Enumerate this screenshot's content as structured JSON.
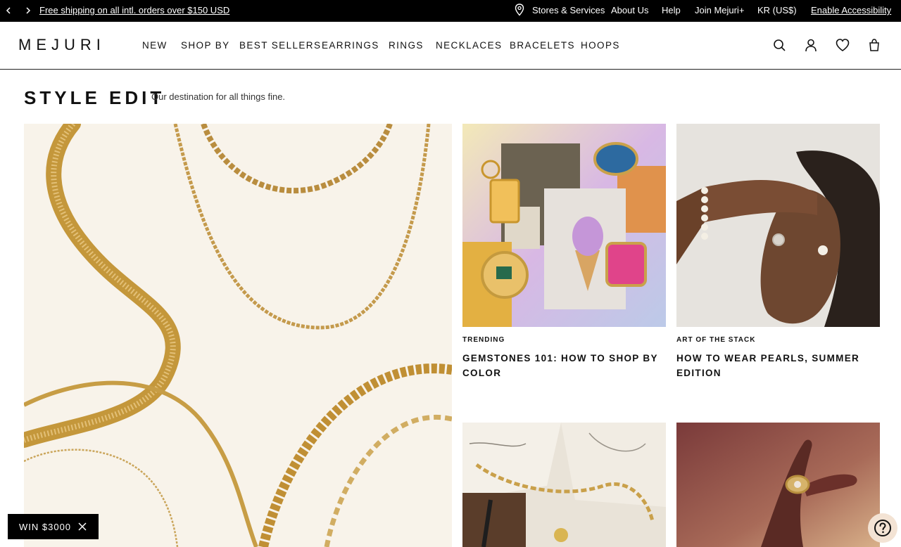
{
  "topbar": {
    "promo": "Free shipping on all intl. orders over $150 USD",
    "stores": "Stores & Services",
    "about": "About Us",
    "help": "Help",
    "join": "Join Mejuri+",
    "currency": "KR (US$)",
    "accessibility": "Enable Accessibility"
  },
  "header": {
    "logo": "MEJURI",
    "nav": [
      "NEW",
      "SHOP BY",
      "BEST SELLERS",
      "EARRINGS",
      "RINGS",
      "NECKLACES",
      "BRACELETS",
      "HOOPS"
    ]
  },
  "page": {
    "title": "STYLE EDIT",
    "subtitle": "Our destination for all things fine."
  },
  "cards": [
    {
      "tag": "TRENDING",
      "title": "GEMSTONES 101: HOW TO SHOP BY COLOR"
    },
    {
      "tag": "ART OF THE STACK",
      "title": "HOW TO WEAR PEARLS, SUMMER EDITION"
    }
  ],
  "floating": {
    "win": "WIN $3000"
  },
  "colors": {
    "gold": "#c9a04a",
    "hero_bg": "#f8f3ea",
    "topbar_bg": "#000000"
  }
}
